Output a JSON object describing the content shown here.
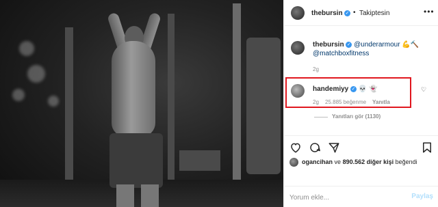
{
  "header": {
    "username": "thebursin",
    "separator": "•",
    "follow_status": "Takiptesin",
    "more_icon": "ellipsis-icon"
  },
  "caption": {
    "username": "thebursin",
    "mention_1": "@underarmour",
    "emoji_1": "💪🔨",
    "mention_2": "@matchboxfitness",
    "time": "2g"
  },
  "highlighted_comment": {
    "username": "handemiyy",
    "emojis": "💀 👻",
    "time": "2g",
    "likes": "25.885 beğenme",
    "reply": "Yanıtla",
    "border_color": "#e0161e"
  },
  "replies": {
    "label": "Yanıtları gör (1130)"
  },
  "liked_by": {
    "user": "ogancihan",
    "connector": "ve",
    "count": "890.562 diğer kişi",
    "suffix": "beğendi"
  },
  "comment": {
    "placeholder": "Yorum ekle...",
    "post_label": "Paylaş"
  },
  "colors": {
    "verified": "#3897f0",
    "mention": "#00376b",
    "muted": "#8e8e8e",
    "post_disabled": "#b2dffc"
  }
}
